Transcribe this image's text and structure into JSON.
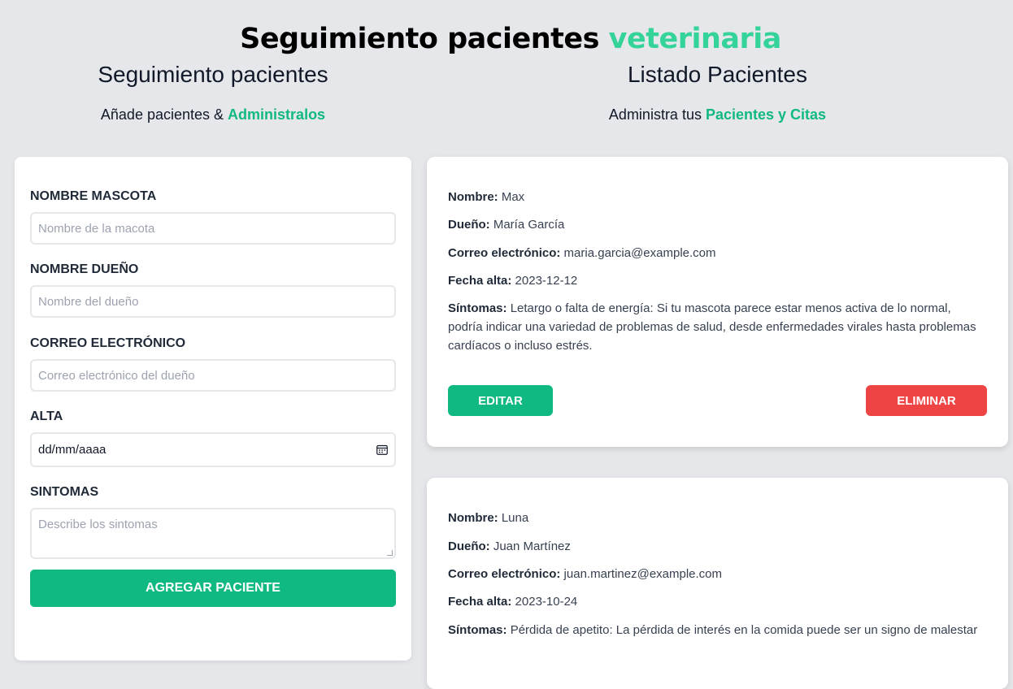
{
  "header": {
    "title_main": "Seguimiento pacientes",
    "title_accent": "veterinaria",
    "accent_color": "#34d399"
  },
  "form_section": {
    "title": "Seguimiento pacientes",
    "subtitle_prefix": "Añade pacientes &",
    "subtitle_accent": "Administralos"
  },
  "list_section": {
    "title": "Listado Pacientes",
    "subtitle_prefix": "Administra tus",
    "subtitle_accent": "Pacientes y Citas"
  },
  "form": {
    "pet_name": {
      "label": "NOMBRE MASCOTA",
      "placeholder": "Nombre de la macota",
      "value": ""
    },
    "owner_name": {
      "label": "NOMBRE DUEÑO",
      "placeholder": "Nombre del dueño",
      "value": ""
    },
    "email": {
      "label": "CORREO ELECTRÓNICO",
      "placeholder": "Correo electrónico del dueño",
      "value": ""
    },
    "date": {
      "label": "ALTA",
      "value": "dd/mm/aaaa",
      "icon": "calendar-icon"
    },
    "symptoms": {
      "label": "SINTOMAS",
      "placeholder": "Describe los sintomas",
      "value": ""
    },
    "submit_label": "AGREGAR PACIENTE"
  },
  "labels": {
    "name": "Nombre:",
    "owner": "Dueño:",
    "email": "Correo electrónico:",
    "date": "Fecha alta:",
    "symptoms": "Síntomas:"
  },
  "patients": [
    {
      "name": "Max",
      "owner": "María García",
      "email": "maria.garcia@example.com",
      "date": "2023-12-12",
      "symptoms": "Letargo o falta de energía: Si tu mascota parece estar menos activa de lo normal, podría indicar una variedad de problemas de salud, desde enfermedades virales hasta problemas cardíacos o incluso estrés.",
      "edit_label": "EDITAR",
      "delete_label": "ELIMINAR"
    },
    {
      "name": "Luna",
      "owner": "Juan Martínez",
      "email": "juan.martinez@example.com",
      "date": "2023-10-24",
      "symptoms": "Pérdida de apetito: La pérdida de interés en la comida puede ser un signo de malestar"
    }
  ],
  "colors": {
    "background": "#e5e7eb",
    "primary": "#10b981",
    "danger": "#ef4444"
  }
}
